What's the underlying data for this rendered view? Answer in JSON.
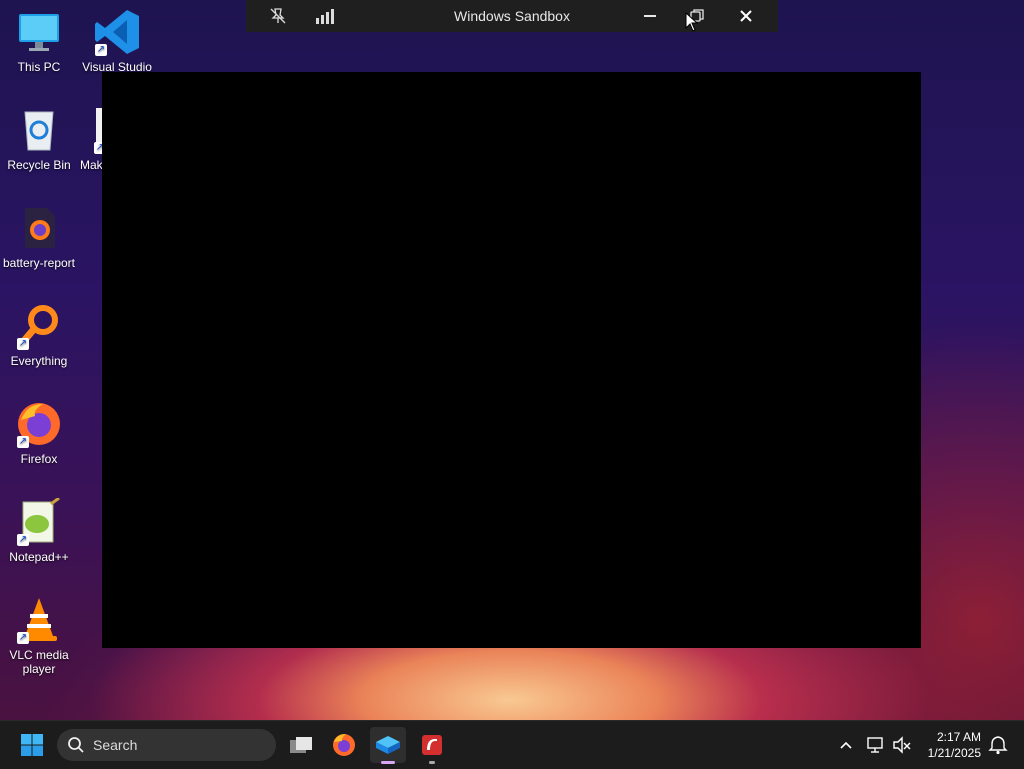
{
  "desktop": {
    "icons": [
      {
        "label": "This PC",
        "icon": "monitor-icon"
      },
      {
        "label": "Visual Studio",
        "icon": "vscode-icon"
      },
      {
        "label": "Recycle Bin",
        "icon": "recycle-bin-icon"
      },
      {
        "label": "Mak",
        "icon": "file-icon"
      },
      {
        "label": "battery-report",
        "icon": "firefox-html-file-icon"
      },
      {
        "label": "Everything",
        "icon": "everything-search-icon"
      },
      {
        "label": "Firefox",
        "icon": "firefox-icon"
      },
      {
        "label": "Notepad++",
        "icon": "notepad-plus-plus-icon"
      },
      {
        "label": "VLC media player",
        "icon": "vlc-icon"
      }
    ]
  },
  "sandbox": {
    "title": "Windows Sandbox",
    "controls": [
      "unpin-icon",
      "connection-bars-icon",
      "minimize-icon",
      "restore-icon",
      "close-icon"
    ]
  },
  "taskbar": {
    "search_placeholder": "Search",
    "apps": [
      "start-icon",
      "task-view-icon",
      "firefox-icon",
      "windows-sandbox-icon",
      "app-icon"
    ],
    "clock": {
      "time": "2:17 AM",
      "date": "1/21/2025"
    }
  },
  "colors": {
    "taskbar": "#1c1c1c",
    "title_bar": "#1f1f1f",
    "accent": "#0078d4"
  }
}
